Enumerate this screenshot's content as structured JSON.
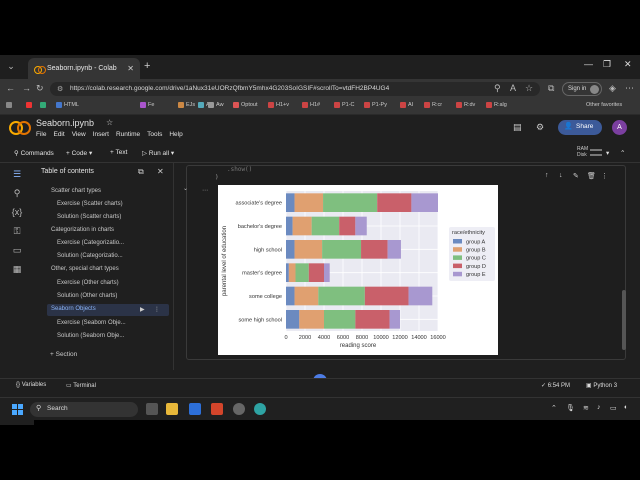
{
  "browser": {
    "tab_title": "Seaborn.ipynb - Colab",
    "url": "https://colab.research.google.com/drive/1aNux31eUORzQfbmY5mhx4G203SoIGSIF#scrollTo=vtdFH2BP4UG4",
    "signin_label": "Sign in",
    "bookmarks": [
      "HTML",
      "Fe",
      "EJs",
      "As",
      "Aw",
      "Optout",
      "H1+v",
      "H1#",
      "P1-C",
      "P1-Py",
      "AI",
      "R:cr",
      "R:dv",
      "R:alg"
    ],
    "other_bookmarks": "Other favorites"
  },
  "colab": {
    "title": "Seaborn.ipynb",
    "menu": [
      "File",
      "Edit",
      "View",
      "Insert",
      "Runtime",
      "Tools",
      "Help"
    ],
    "share_label": "Share",
    "user_initial": "A",
    "toolbar": {
      "commands": "Commands",
      "code": "+ Code",
      "text": "+ Text",
      "run_all": "Run all",
      "ram": "RAM",
      "disk": "Disk"
    }
  },
  "toc": {
    "title": "Table of contents",
    "items": [
      {
        "label": "Scatter chart types",
        "level": 1
      },
      {
        "label": "Exercise (Scatter charts)",
        "level": 2
      },
      {
        "label": "Solution (Scatter charts)",
        "level": 2
      },
      {
        "label": "Categorization in charts",
        "level": 1
      },
      {
        "label": "Exercise (Categorizatio...",
        "level": 2
      },
      {
        "label": "Solution (Categorizatio...",
        "level": 2
      },
      {
        "label": "Other, special chart types",
        "level": 1
      },
      {
        "label": "Exercise (Other charts)",
        "level": 2
      },
      {
        "label": "Solution (Other charts)",
        "level": 2
      },
      {
        "label": "Seaborn Objects",
        "level": 1,
        "selected": true
      },
      {
        "label": "Exercise (Seaborn Obje...",
        "level": 2
      },
      {
        "label": "Solution (Seaborn Obje...",
        "level": 2
      }
    ],
    "add_section": "Section"
  },
  "cell": {
    "code_fragment": "(\n    ...\n    ).show()",
    "code_line1": "    .show()",
    "code_line2": ")"
  },
  "chart_data": {
    "type": "bar",
    "orientation": "horizontal",
    "stacked": true,
    "categories": [
      "associate's degree",
      "bachelor's degree",
      "high school",
      "master's degree",
      "some college",
      "some high school"
    ],
    "series": [
      {
        "name": "group A",
        "color": "#6b8ac0",
        "values": [
          900,
          700,
          900,
          300,
          900,
          1400
        ]
      },
      {
        "name": "group B",
        "color": "#e0a070",
        "values": [
          3000,
          2000,
          2900,
          700,
          2500,
          2600
        ]
      },
      {
        "name": "group C",
        "color": "#7fbf7f",
        "values": [
          5700,
          2900,
          4100,
          1400,
          4900,
          3300
        ]
      },
      {
        "name": "group D",
        "color": "#c9606a",
        "values": [
          3600,
          1700,
          2800,
          1600,
          4600,
          3600
        ]
      },
      {
        "name": "group E",
        "color": "#a898d0",
        "values": [
          2800,
          1200,
          1400,
          600,
          2500,
          1100
        ]
      }
    ],
    "xlabel": "reading score",
    "ylabel": "parental level of education",
    "xticks": [
      0,
      2000,
      4000,
      6000,
      8000,
      10000,
      12000,
      14000,
      16000
    ],
    "xlim": [
      0,
      16000
    ],
    "legend_title": "race/ethnicity",
    "legend_position": "right",
    "background": "#eaeaf2",
    "grid": true
  },
  "statusbar": {
    "variables": "Variables",
    "terminal": "Terminal",
    "time": "6:54 PM",
    "runtime": "Python 3"
  },
  "taskbar": {
    "search": "Search"
  }
}
